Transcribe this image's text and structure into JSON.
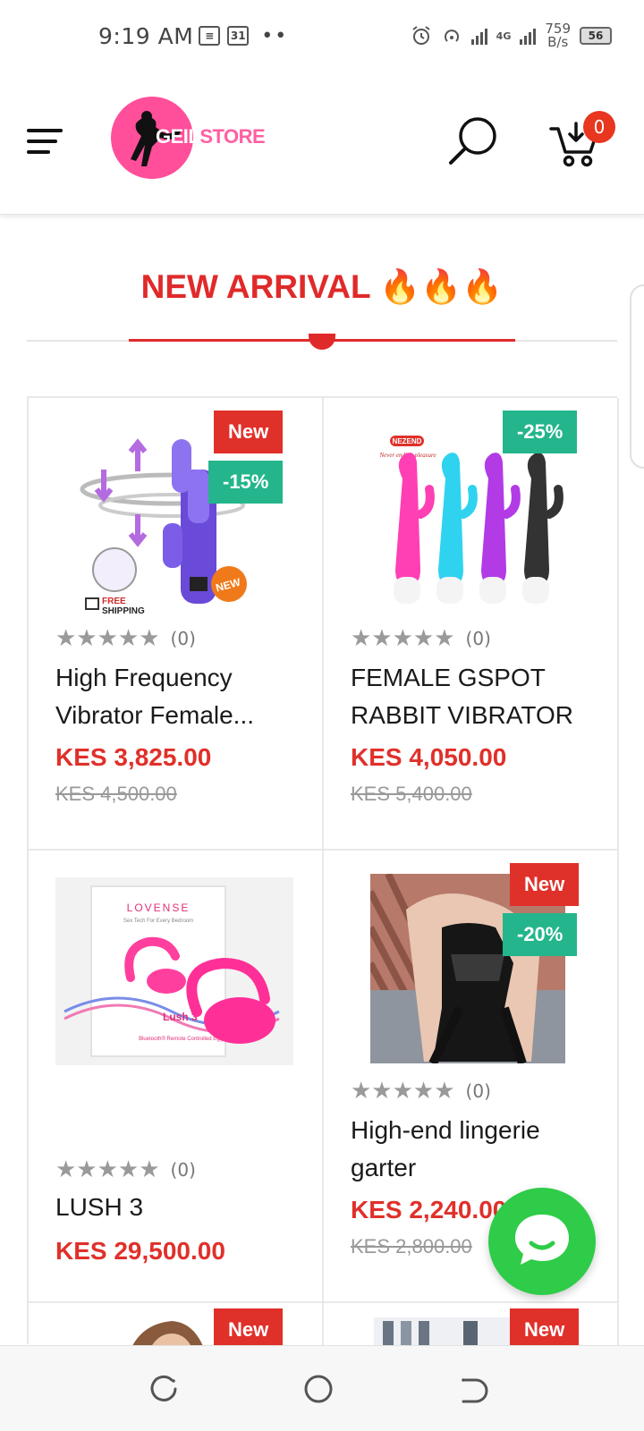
{
  "status_bar": {
    "time": "9:19 AM",
    "calendar_day": "31",
    "network_type": "4G",
    "speed_value": "759",
    "speed_unit": "B/s",
    "battery": "56"
  },
  "header": {
    "logo_text_first": "GEIL",
    "logo_text_second": "STORE",
    "cart_count": "0"
  },
  "section": {
    "title": "NEW ARRIVAL 🔥🔥🔥"
  },
  "products": [
    {
      "name": "High Frequency Vibrator Female...",
      "rating_count": "(0)",
      "price": "KES 3,825.00",
      "old_price": "KES 4,500.00",
      "new_badge": "New",
      "discount_badge": "-15%",
      "image_label_free": "FREE",
      "image_label_shipping": "SHIPPING",
      "image_label_new": "NEW"
    },
    {
      "name": "FEMALE GSPOT RABBIT VIBRATOR",
      "rating_count": "(0)",
      "price": "KES 4,050.00",
      "old_price": "KES 5,400.00",
      "discount_badge": "-25%",
      "image_brand": "NEZEND",
      "image_tagline": "Never ending pleasure"
    },
    {
      "name": "LUSH 3",
      "rating_count": "(0)",
      "price": "KES 29,500.00",
      "image_brand": "LOVENSE",
      "image_tagline": "Sex Tech For Every Bedroom",
      "image_product": "Lush 3",
      "image_subline": "Bluetooth® Remote Controlled Egg"
    },
    {
      "name": "High-end lingerie garter",
      "rating_count": "(0)",
      "price": "KES 2,240.00",
      "old_price": "KES 2,800.00",
      "new_badge": "New",
      "discount_badge": "-20%"
    }
  ],
  "partial_row": {
    "left_badge": "New",
    "right_badge": "New"
  },
  "icons": {
    "menu": "hamburger-icon",
    "search": "search-icon",
    "cart": "cart-icon",
    "chat": "chat-bubble-icon"
  },
  "colors": {
    "accent_red": "#e0302a",
    "discount_green": "#24b58c",
    "chat_green": "#2ecc48",
    "logo_pink": "#ff4f9a"
  }
}
